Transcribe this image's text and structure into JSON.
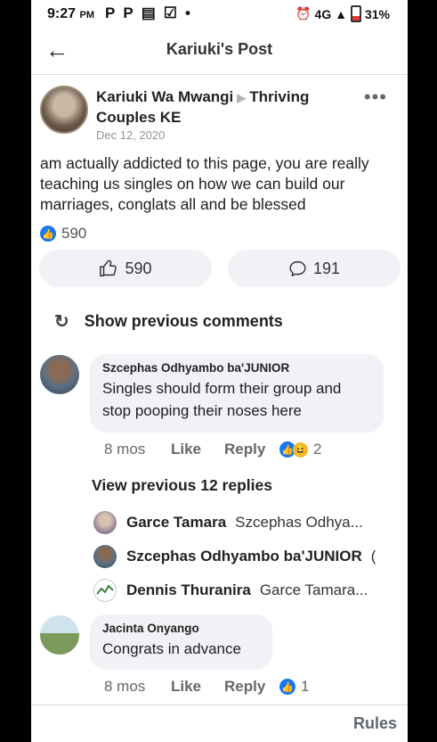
{
  "status_bar": {
    "time": "9:27",
    "ampm": "PM",
    "left_icons": [
      "P",
      "P",
      "▤",
      "☑",
      "•"
    ],
    "right_icons": [
      "⏰",
      "4G ▲"
    ],
    "battery": "31%"
  },
  "topbar": {
    "title": "Kariuki's Post"
  },
  "post": {
    "author": "Kariuki Wa Mwangi",
    "group": "Thriving Couples KE",
    "date": "Dec 12, 2020",
    "text": "am actually addicted to this page, you are really teaching us singles on how we can build our marriages, conglats all and be blessed",
    "reaction_count": "590",
    "like_button_count": "590",
    "comment_button_count": "191"
  },
  "show_previous_comments": "Show previous comments",
  "comments": [
    {
      "author": "Szcephas Odhyambo ba'JUNIOR",
      "text": "Singles should form their group and stop pooping their noses here",
      "time": "8 mos",
      "like": "Like",
      "reply": "Reply",
      "reaction_count": "2"
    },
    {
      "author": "Jacinta Onyango",
      "text": "Congrats in advance",
      "time": "8 mos",
      "like": "Like",
      "reply": "Reply",
      "reaction_count": "1"
    }
  ],
  "view_replies": "View previous 12 replies",
  "replies": [
    {
      "name": "Garce Tamara",
      "snippet": "Szcephas Odhya..."
    },
    {
      "name": "Szcephas Odhyambo ba'JUNIOR",
      "snippet": "("
    },
    {
      "name": "Dennis Thuranira",
      "snippet": "Garce Tamara..."
    }
  ],
  "footer": {
    "rules": "Rules"
  },
  "colors": {
    "brand_blue": "#1877f2",
    "bubble_gray": "#f0f2f5",
    "meta_gray": "#65676b"
  }
}
